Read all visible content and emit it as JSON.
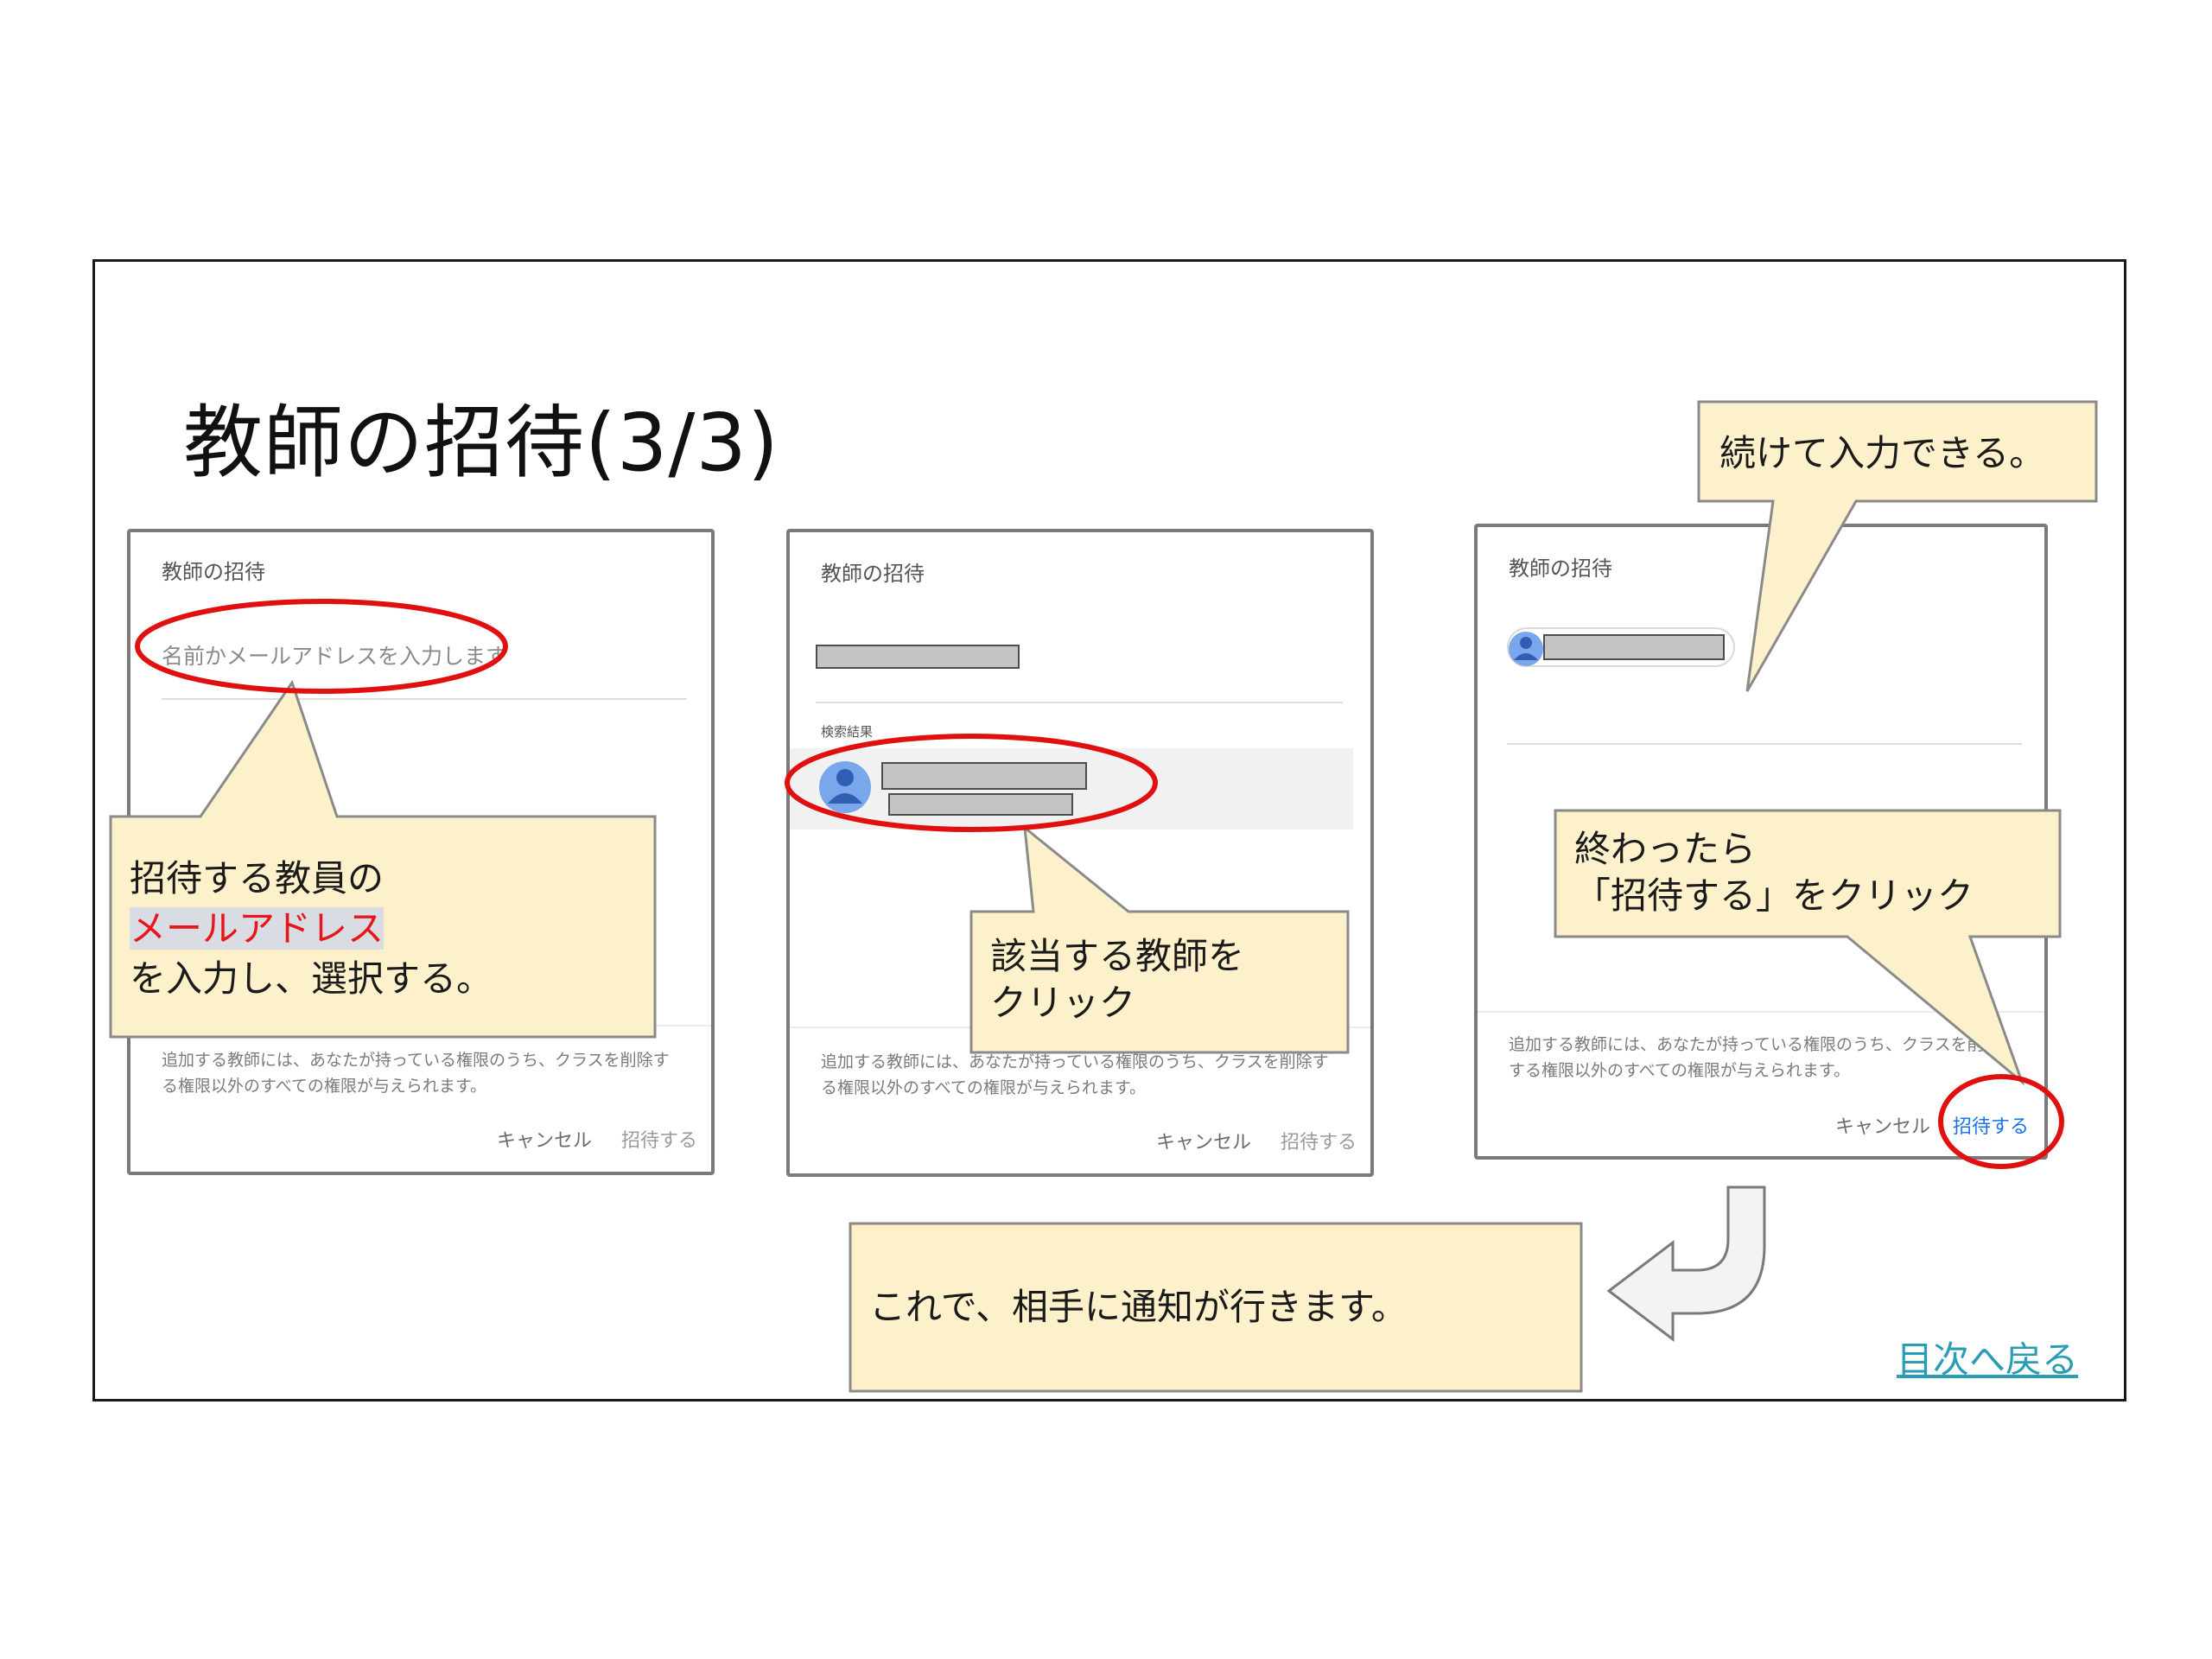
{
  "slide": {
    "title": "教師の招待(3/3)",
    "back_link": "目次へ戻る"
  },
  "dialog": {
    "title": "教師の招待",
    "placeholder": "名前かメールアドレスを入力します",
    "results_label": "検索結果",
    "note": "追加する教師には、あなたが持っている権限のうち、クラスを削除する権限以外のすべての権限が与えられます。",
    "cancel": "キャンセル",
    "invite": "招待する"
  },
  "callouts": {
    "step1_line1": "招待する教員の",
    "step1_highlight": "メールアドレス",
    "step1_line3": "を入力し、選択する。",
    "step2_line1": "該当する教師を",
    "step2_line2": "クリック",
    "step3a": "続けて入力できる。",
    "step3b_line1": "終わったら",
    "step3b_line2": "「招待する」をクリック",
    "done": "これで、相手に通知が行きます。"
  },
  "colors": {
    "callout_fill": "#fdf1cc",
    "callout_stroke": "#8a8a8a",
    "ellipse_red": "#e01010",
    "link": "#2a9db4",
    "invite_blue": "#1a73e8",
    "avatar_blue": "#7aa7ec"
  }
}
